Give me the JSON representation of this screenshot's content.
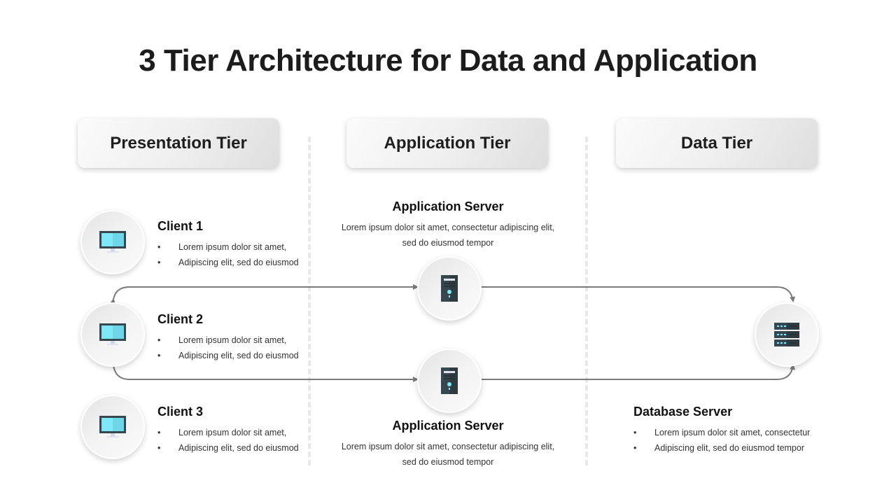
{
  "title": "3 Tier Architecture for Data and Application",
  "tiers": [
    {
      "label": "Presentation Tier"
    },
    {
      "label": "Application Tier"
    },
    {
      "label": "Data Tier"
    }
  ],
  "clients": [
    {
      "title": "Client 1",
      "bullets": [
        "Lorem ipsum dolor sit amet,",
        "Adipiscing elit, sed do eiusmod"
      ],
      "icon": "monitor-icon"
    },
    {
      "title": "Client 2",
      "bullets": [
        "Lorem ipsum dolor sit amet,",
        "Adipiscing elit, sed do eiusmod"
      ],
      "icon": "monitor-icon"
    },
    {
      "title": "Client 3",
      "bullets": [
        "Lorem ipsum dolor sit amet,",
        "Adipiscing elit, sed do eiusmod"
      ],
      "icon": "monitor-icon"
    }
  ],
  "app_servers": [
    {
      "title": "Application Server",
      "desc_line1": "Lorem ipsum dolor sit amet, consectetur adipiscing elit,",
      "desc_line2": "sed do eiusmod tempor",
      "icon": "server-tower-icon"
    },
    {
      "title": "Application Server",
      "desc_line1": "Lorem ipsum dolor sit amet, consectetur adipiscing elit,",
      "desc_line2": "sed do eiusmod tempor",
      "icon": "server-tower-icon"
    }
  ],
  "database_server": {
    "title": "Database Server",
    "bullets": [
      "Lorem ipsum dolor sit amet, consectetur",
      "Adipiscing elit, sed do eiusmod tempor"
    ],
    "icon": "server-rack-icon"
  },
  "bullet_char": "•",
  "colors": {
    "screen": "#7ee8f8",
    "screen_dark": "#6fd6ea",
    "bezel": "#37474f",
    "arrow": "#7a7a7a",
    "divider": "#e8e8e8"
  }
}
